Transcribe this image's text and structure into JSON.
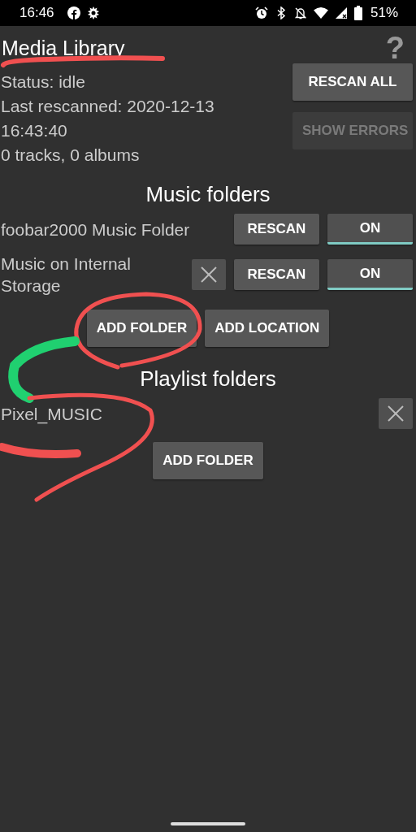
{
  "status_bar": {
    "time": "16:46",
    "battery": "51%"
  },
  "header": {
    "title": "Media Library",
    "help": "?"
  },
  "status": {
    "lines": [
      "Status: idle",
      "Last rescanned: 2020-12-13 16:43:40",
      "0 tracks, 0 albums"
    ],
    "buttons": [
      {
        "label": "RESCAN ALL",
        "disabled": false
      },
      {
        "label": "SHOW ERRORS",
        "disabled": true
      }
    ]
  },
  "music_folders": {
    "heading": "Music folders",
    "rows": [
      {
        "name": "foobar2000 Music Folder",
        "removable": false,
        "rescan": "RESCAN",
        "toggle": {
          "label": "ON",
          "on": true
        }
      },
      {
        "name": "Music on Internal Storage",
        "removable": true,
        "rescan": "RESCAN",
        "toggle": {
          "label": "ON",
          "on": true
        }
      }
    ],
    "buttons": [
      "ADD FOLDER",
      "ADD LOCATION"
    ]
  },
  "playlist_folders": {
    "heading": "Playlist folders",
    "rows": [
      {
        "name": "Pixel_MUSIC",
        "removable": true
      }
    ],
    "buttons": [
      "ADD FOLDER"
    ]
  }
}
